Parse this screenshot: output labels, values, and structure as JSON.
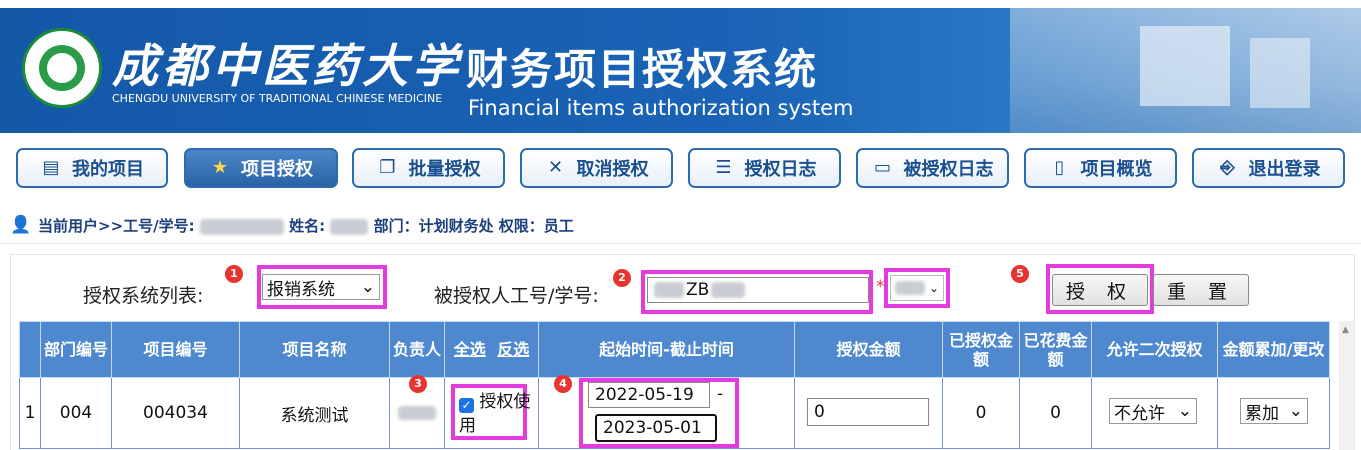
{
  "header": {
    "cn_university": "成都中医药大学",
    "en_university": "CHENGDU UNIVERSITY OF TRADITIONAL CHINESE MEDICINE",
    "system_title": "财务项目授权系统",
    "system_subtitle": "Financial items authorization system"
  },
  "nav": {
    "items": [
      {
        "label": "我的项目",
        "icon": "list-icon"
      },
      {
        "label": "项目授权",
        "icon": "star-icon",
        "active": true
      },
      {
        "label": "批量授权",
        "icon": "stack-icon"
      },
      {
        "label": "取消授权",
        "icon": "cancel-icon"
      },
      {
        "label": "授权日志",
        "icon": "log-icon"
      },
      {
        "label": "被授权日志",
        "icon": "doc-icon"
      },
      {
        "label": "项目概览",
        "icon": "overview-icon"
      },
      {
        "label": "退出登录",
        "icon": "logout-icon"
      }
    ]
  },
  "userbar": {
    "prefix": "当前用户>>工号/学号:",
    "name_label": "姓名:",
    "dept_text": "部门：计划财务处 权限：员工"
  },
  "form": {
    "system_list_label": "授权系统列表:",
    "system_selected": "报销系统",
    "grantee_label": "被授权人工号/学号:",
    "grantee_value_visible": "ZB",
    "required_mark": "*",
    "authorize_button": "授 权",
    "reset_button": "重 置",
    "badges": [
      "1",
      "2",
      "3",
      "4",
      "5"
    ]
  },
  "table": {
    "headers": [
      "部门编号",
      "项目编号",
      "项目名称",
      "负责人",
      "起始时间-截止时间",
      "授权金额",
      "已授权金额",
      "已花费金额",
      "允许二次授权",
      "金额累加/更改"
    ],
    "select_all": "全选",
    "invert_select": "反选",
    "rows": [
      {
        "index": "1",
        "dept_code": "004",
        "project_code": "004034",
        "project_name": "系统测试",
        "auth_checkbox_label": "授权使用",
        "auth_checked": true,
        "start_date": "2022-05-19",
        "date_separator": "-",
        "end_date": "2023-05-01",
        "amount": "0",
        "authorized_amount": "0",
        "spent_amount": "0",
        "second_auth": "不允许",
        "amount_mode": "累加"
      }
    ]
  }
}
